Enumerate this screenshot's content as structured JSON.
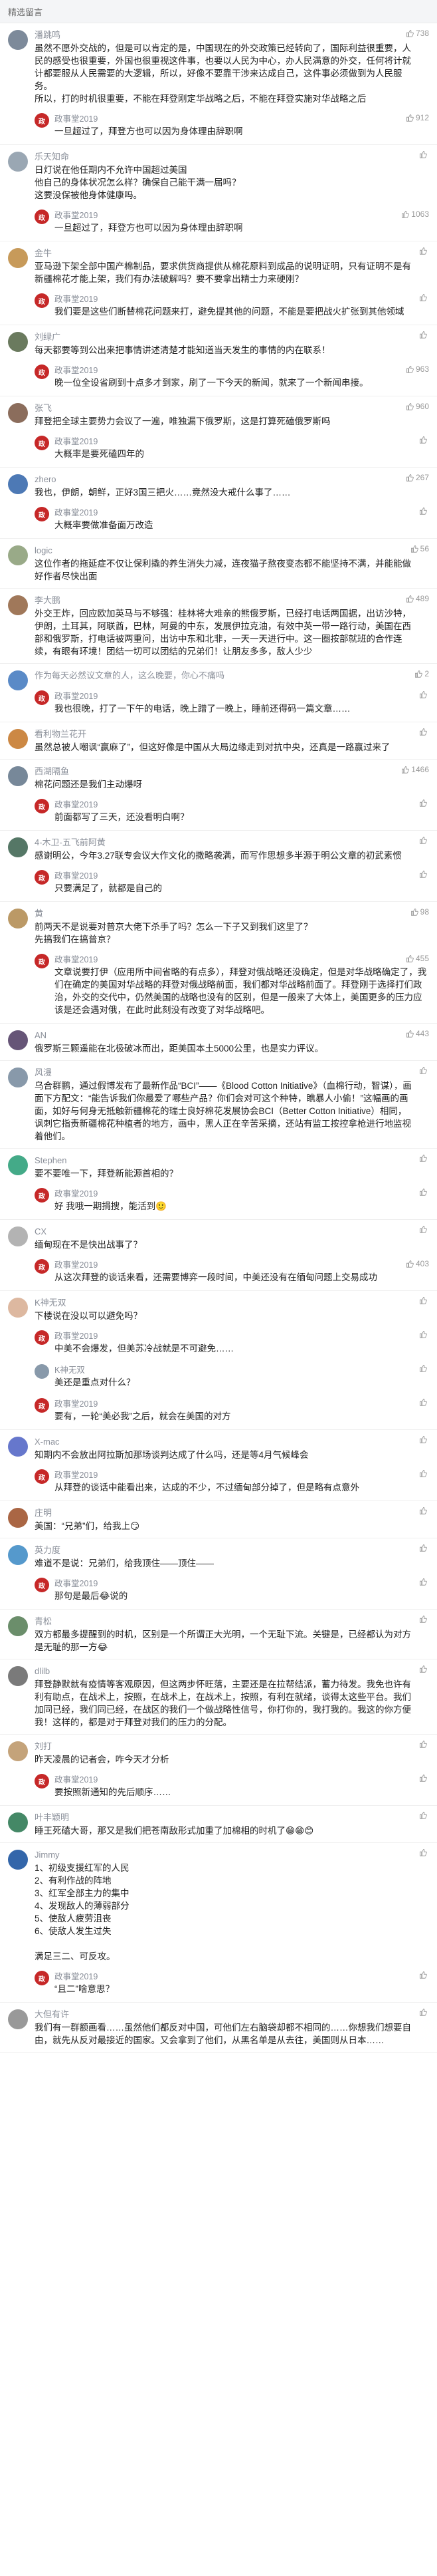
{
  "section_title": "精选留言",
  "comments": [
    {
      "user": "潘跳鸣",
      "likes": "738",
      "color": "#7d8a9a",
      "text": "虽然不愿外交战的，但是可以肯定的是，中国现在的外交政策已经转向了，国际利益很重要，人民的感受也很重要，外国也很重视这件事，也要以人民为中心，办人民满意的外交，任何将计就计都要服从人民需要的大逻辑，所以，好像不要靠干涉来达成自己，这件事必须做到为人民服务。\n所以，打的时机很重要，不能在拜登刚定华战略之后，不能在拜登实施对华战略之后",
      "replies": [
        {
          "user": "政事堂2019",
          "likes": "912",
          "text": "一旦超过了，拜登方也可以因为身体理由辞职啊"
        }
      ]
    },
    {
      "user": "乐天知命",
      "likes": "",
      "color": "#9aa7b3",
      "text": "日灯说在他任期内不允许中国超过美国\n他自己的身体状况怎么样？确保自己能干满一届吗？\n这要没保被他身体健康吗。",
      "replies": [
        {
          "user": "政事堂2019",
          "likes": "1063",
          "text": "一旦超过了，拜登方也可以因为身体理由辞职啊"
        }
      ]
    },
    {
      "user": "金牛",
      "likes": "",
      "color": "#c79a5a",
      "text": "亚马逊下架全部中国产棉制品，要求供货商提供从棉花原料到成品的说明证明，只有证明不是有新疆棉花才能上架，我们有办法破解吗？要不要拿出精士力来硬刚？",
      "replies": [
        {
          "user": "政事堂2019",
          "likes": "",
          "text": "我们要是这些们断替棉花问题来打，避免提其他的问题，不能是要把战火扩张到其他领域"
        }
      ]
    },
    {
      "user": "刘绿广",
      "likes": "",
      "color": "#6a7a5e",
      "text": "每天都要等到公出来把事情讲述清楚才能知道当天发生的事情的内在联系！",
      "replies": [
        {
          "user": "政事堂2019",
          "likes": "963",
          "text": "晚一位全设省刷到十点多才到家，刷了一下今天的新闻，就来了一个新闻串接。"
        }
      ]
    },
    {
      "user": "张飞",
      "likes": "960",
      "color": "#8b6d5c",
      "text": "拜登把全球主要势力会议了一遍，唯独漏下俄罗斯，这是打算死磕俄罗斯吗",
      "replies": [
        {
          "user": "政事堂2019",
          "likes": "",
          "text": "大概率是要死磕四年的"
        }
      ]
    },
    {
      "user": "zhero",
      "likes": "267",
      "color": "#4d79b5",
      "text": "我也，伊朗，朝鲜，正好3国三把火……竟然没大戒什么事了……",
      "replies": [
        {
          "user": "政事堂2019",
          "likes": "",
          "text": "大概率要做准备面万改造"
        }
      ]
    },
    {
      "user": "logic",
      "likes": "56",
      "color": "#99aa88",
      "text": "这位作者的拖延症不仅让保利撬的养生消失力减，连夜猫子熬夜变态都不能坚持不满，并能能做好作者尽快出面",
      "replies": []
    },
    {
      "user": "李大鹏",
      "likes": "489",
      "color": "#a0785a",
      "text": "外交王炸，回应欧加英马与不够强：桂林将大难亲的熊俄罗斯，已经打电话两国据，出访沙特，伊朗，土耳其，阿联酋，巴林，阿曼的中东，发展伊拉克油，有效中英一带一路行动，美国在西部和俄罗斯，打电话被两重问，出访中东和北非，一天一天进行中。这一圈按部就班的合作连续，有眼有环境！团结一切可以团结的兄弟们！让朋友多多，敌人少少",
      "replies": []
    },
    {
      "user": "作为每天必然议文章的人，这么晚要，你心不痛吗",
      "likes": "2",
      "color": "#5a8ac7",
      "text": "",
      "replies": [
        {
          "user": "政事堂2019",
          "likes": "",
          "text": "我也很晚，打了一下午的电话，晚上蹭了一晚上，睡前还得码一篇文章……"
        }
      ]
    },
    {
      "user": "看利物兰花开",
      "likes": "",
      "color": "#cc8844",
      "text": "虽然总被人嘲讽“赢麻了”，但这好像是中国从大局边缘走到对抗中央，还真是一路赢过来了",
      "replies": []
    },
    {
      "user": "西湖隔鱼",
      "likes": "1466",
      "color": "#778899",
      "text": "棉花问题还是我们主动爆呀",
      "replies": [
        {
          "user": "政事堂2019",
          "likes": "",
          "text": "前面都写了三天，还没看明白啊？"
        }
      ]
    },
    {
      "user": "4-木卫-五飞前阿黄",
      "likes": "",
      "color": "#557766",
      "text": "感谢明公，今年3.27联专会议大作文化的撒略袭满，而写作思想多半源于明公文章的初武素惯",
      "replies": [
        {
          "user": "政事堂2019",
          "likes": "",
          "text": "只要满足了，就都是自己的"
        }
      ]
    },
    {
      "user": "黄",
      "likes": "98",
      "color": "#bb9966",
      "text": "前两天不是说要对普京大佬下杀手了吗？怎么一下子又到我们这里了？\n先搞我们在搞普京？",
      "replies": [
        {
          "user": "政事堂2019",
          "likes": "455",
          "text": "文章说要打伊（应用所中间省略的有点多），拜登对俄战略还没确定，但是对华战略确定了，我们在确定的美国对华战略的拜登对俄战略前面，我们都对华战略前面了。拜登刚于选择打们政治，外交的交代中，仍然美国的战略也没有的区别，但是一般来了大体上，美国更多的压力应该是还会遇对俄，在此时此刻没有改变了对华战略吧。"
        }
      ]
    },
    {
      "user": "AN",
      "likes": "443",
      "color": "#665577",
      "text": "俄罗斯三颗遥能在北极破冰而出，距美国本土5000公里，也是实力评议。",
      "replies": []
    },
    {
      "user": "风漫",
      "likes": "",
      "color": "#8899aa",
      "text": "乌合群鹏，通过假博发布了最新作品“BCI”——《Blood Cotton Initiative》（血棉行动，智谋），画面下方配文：“能告诉我们你最爱了哪些产品？你们会对可这个种特，瞧暴人小偷！”这幅画的画面，如好与何身无抵触新疆棉花的瑞士良好棉花发展协会BCI（Better Cotton Initiative）相同，讽刺它指责新疆棉花种植者的地方，画中，黑人正在辛苦采摘，还站有监工按控拿枪进行地监视着他们。",
      "replies": []
    },
    {
      "user": "Stephen",
      "likes": "",
      "color": "#44aa88",
      "text": "要不要唯一下，拜登新能源首相的？",
      "replies": [
        {
          "user": "政事堂2019",
          "likes": "",
          "text": "好 我哦一期捐搜，能活到🙂"
        }
      ]
    },
    {
      "user": "CX",
      "likes": "",
      "color": "#b3b3b3",
      "text": "缅甸现在不是快出战事了？",
      "replies": [
        {
          "user": "政事堂2019",
          "likes": "403",
          "text": "从这次拜登的谈话来看，还需要博弈一段时间，中美还没有在缅甸问题上交易成功"
        }
      ]
    },
    {
      "user": "K神无双",
      "likes": "",
      "color": "#ddb8a0",
      "text": "下楼说在没以可以避免吗？",
      "replies": [
        {
          "user": "政事堂2019",
          "likes": "",
          "text": "中美不会爆发，但美苏冷战就是不可避免……"
        },
        {
          "user": "K神无双",
          "likes": "",
          "text": "美还是重点对什么？"
        },
        {
          "user": "政事堂2019",
          "likes": "",
          "text": "要有，一轮“美必我”之后，就会在美国的对方"
        }
      ]
    },
    {
      "user": "X-mac",
      "likes": "",
      "color": "#6677cc",
      "text": "知期内不会放出阿拉斯加那场谈判达成了什么吗，还是等4月气候峰会",
      "replies": [
        {
          "user": "政事堂2019",
          "likes": "",
          "text": "从拜登的谈话中能看出来，达成的不少，不过缅甸部分掉了，但是略有点意外"
        }
      ]
    },
    {
      "user": "庄明",
      "likes": "",
      "color": "#aa6644",
      "text": "美国：“兄弟”们，给我上😏",
      "replies": []
    },
    {
      "user": "英力度",
      "likes": "",
      "color": "#5599cc",
      "text": "难道不是说：兄弟们，给我顶住——顶住——",
      "replies": [
        {
          "user": "政事堂2019",
          "likes": "",
          "text": "那句是最后😂说的"
        }
      ]
    },
    {
      "user": "青松",
      "likes": "",
      "color": "#6b8e6b",
      "text": "双方都最多提醒到的时机，区别是一个所谓正大光明，一个无耻下流。关键是，已经都认为对方是无耻的那一方😂",
      "replies": []
    },
    {
      "user": "dlilb",
      "likes": "",
      "color": "#7a7a7a",
      "text": "拜登静默就有疫情等客观原因，但这两步怀旺落，主要还是在拉帮结派，蓄力待发。我免也许有利有助点，在战术上，按照，在战术上，在战术上，按照，有利在就绪，谈得太这些平台。我们加同已经，我们同已经，在战区的我们一个做战略性信号，你打你的，我打我的。我这的你方便我！这样的，都是对于拜登对我们的压力的分配。",
      "replies": []
    },
    {
      "user": "刘打",
      "likes": "",
      "color": "#c4a37a",
      "text": "昨天凌晨的记者会，咋今天才分析",
      "replies": [
        {
          "user": "政事堂2019",
          "likes": "",
          "text": "要按照新通知的先后顺序……"
        }
      ]
    },
    {
      "user": "叶丰颖明",
      "likes": "",
      "color": "#448866",
      "text": "睡王死磕大哥，那又是我们把苍南敌形式加重了加棉相的时机了😁😁😊",
      "replies": []
    },
    {
      "user": "Jimmy",
      "likes": "",
      "color": "#3366aa",
      "text": "1、初级支援红军的人民\n2、有利作战的阵地\n3、红军全部主力的集中\n4、发现敌人的薄弱部分\n5、使敌人疲劳沮丧\n6、使敌人发生过失\n\n满足三二、可反攻。",
      "replies": [
        {
          "user": "政事堂2019",
          "likes": "",
          "text": "“且二”啥意思？"
        }
      ]
    },
    {
      "user": "大但有许",
      "likes": "",
      "color": "#999999",
      "text": "我们有一群额画看……虽然他们都反对中国，可他们左右脑袋却都不相同的……你想我们想要自由，就先从反对最接近的国家。又会拿到了他们，从黑名单是从去往，美国则从日本……",
      "replies": []
    }
  ]
}
